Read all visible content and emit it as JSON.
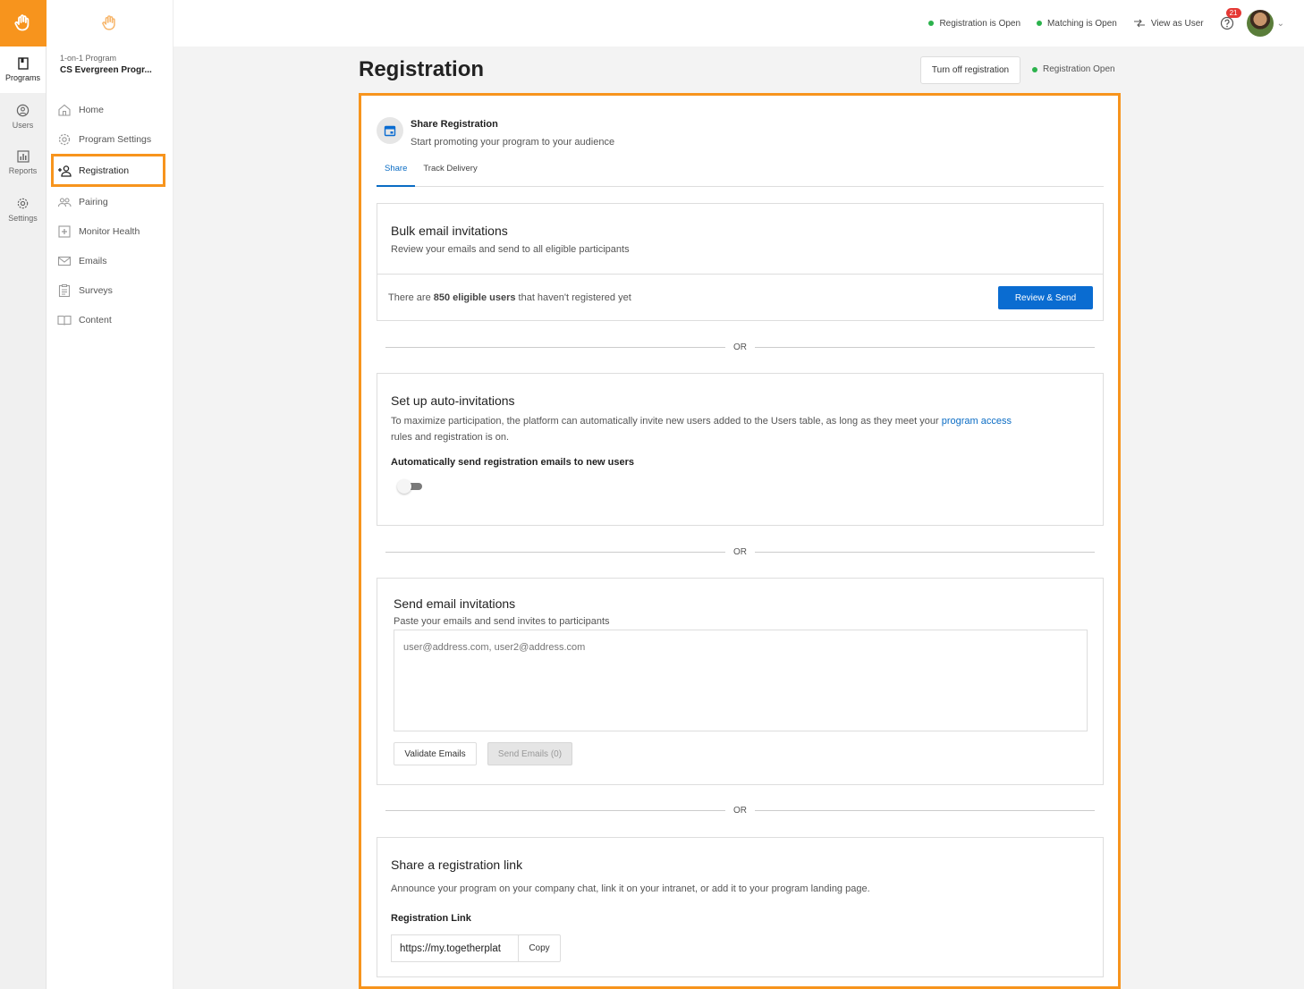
{
  "rail": {
    "items": [
      {
        "label": "Programs",
        "icon": "book-icon"
      },
      {
        "label": "Users",
        "icon": "user-circle-icon"
      },
      {
        "label": "Reports",
        "icon": "bar-chart-icon"
      },
      {
        "label": "Settings",
        "icon": "gear-icon"
      }
    ]
  },
  "sidebar": {
    "program_type": "1-on-1 Program",
    "program_name": "CS Evergreen Progr...",
    "items": [
      {
        "label": "Home"
      },
      {
        "label": "Program Settings"
      },
      {
        "label": "Registration"
      },
      {
        "label": "Pairing"
      },
      {
        "label": "Monitor Health"
      },
      {
        "label": "Emails"
      },
      {
        "label": "Surveys"
      },
      {
        "label": "Content"
      }
    ]
  },
  "topbar": {
    "registration_status": "Registration is Open",
    "matching_status": "Matching is Open",
    "view_as_user": "View as User",
    "notification_count": "21"
  },
  "page": {
    "title": "Registration",
    "turn_off_button": "Turn off registration",
    "registration_state": "Registration Open"
  },
  "share": {
    "title": "Share Registration",
    "subtitle": "Start promoting your program to your audience",
    "tabs": [
      {
        "label": "Share"
      },
      {
        "label": "Track Delivery"
      }
    ]
  },
  "bulk": {
    "title": "Bulk email invitations",
    "description": "Review your emails and send to all eligible participants",
    "count_prefix": "There are ",
    "count_bold": "850 eligible users",
    "count_suffix": " that haven't registered yet",
    "button": "Review & Send"
  },
  "or_label": "OR",
  "auto": {
    "title": "Set up auto-invitations",
    "description_part1": "To maximize participation, the platform can automatically invite new users added to the Users table, as long as they meet your ",
    "link_text": "program access",
    "description_part2": "rules and registration is on.",
    "toggle_label": "Automatically send registration emails to new users",
    "toggle_on": false
  },
  "send": {
    "title": "Send email invitations",
    "description": "Paste your emails and send invites to participants",
    "placeholder": "user@address.com, user2@address.com",
    "validate_button": "Validate Emails",
    "send_button": "Send Emails (0)"
  },
  "link": {
    "title": "Share a registration link",
    "description": "Announce your program on your company chat, link it on your intranet, or add it to your program landing page.",
    "field_label": "Registration Link",
    "url": "https://my.togetherplat",
    "copy_button": "Copy"
  },
  "colors": {
    "brand": "#f7941d",
    "primary": "#0a6cd1",
    "status_green": "#2bb24c",
    "badge_red": "#e53935"
  }
}
